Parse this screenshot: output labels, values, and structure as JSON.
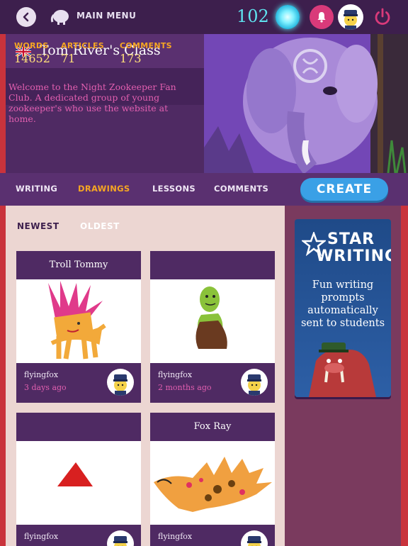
{
  "topbar": {
    "main_menu_label": "MAIN MENU",
    "coins": "102"
  },
  "class": {
    "title": "Tom River's Class",
    "stats": [
      {
        "label": "WORDS",
        "value": "14652"
      },
      {
        "label": "ARTICLES",
        "value": "71"
      },
      {
        "label": "COMMENTS",
        "value": "173"
      }
    ],
    "welcome": "Welcome to the Night Zookeeper Fan Club. A dedicated group of young zookeeper's who use the website at home."
  },
  "nav": {
    "tabs": [
      "WRITING",
      "DRAWINGS",
      "LESSONS",
      "COMMENTS"
    ],
    "active_tab": "DRAWINGS",
    "create_label": "CREATE"
  },
  "sort": {
    "newest": "NEWEST",
    "oldest": "OLDEST"
  },
  "cards": [
    {
      "title": "Troll Tommy",
      "author": "flyingfox",
      "date": "3 days ago",
      "image": "troll-drawing"
    },
    {
      "title": "",
      "author": "flyingfox",
      "date": "2 months ago",
      "image": "green-creature-drawing"
    },
    {
      "title": "",
      "author": "flyingfox",
      "date": "",
      "image": "red-triangle-drawing"
    },
    {
      "title": "Fox Ray",
      "author": "flyingfox",
      "date": "",
      "image": "fox-ray-drawing"
    }
  ],
  "promo": {
    "logo_line1": "STAR",
    "logo_line2": "WRITING",
    "text": "Fun writing prompts automatically sent to students"
  },
  "colors": {
    "accent_orange": "#f5a623",
    "create_blue": "#3aa0e6",
    "pink_text": "#e25fb0",
    "purple_dark": "#4f2a63"
  }
}
